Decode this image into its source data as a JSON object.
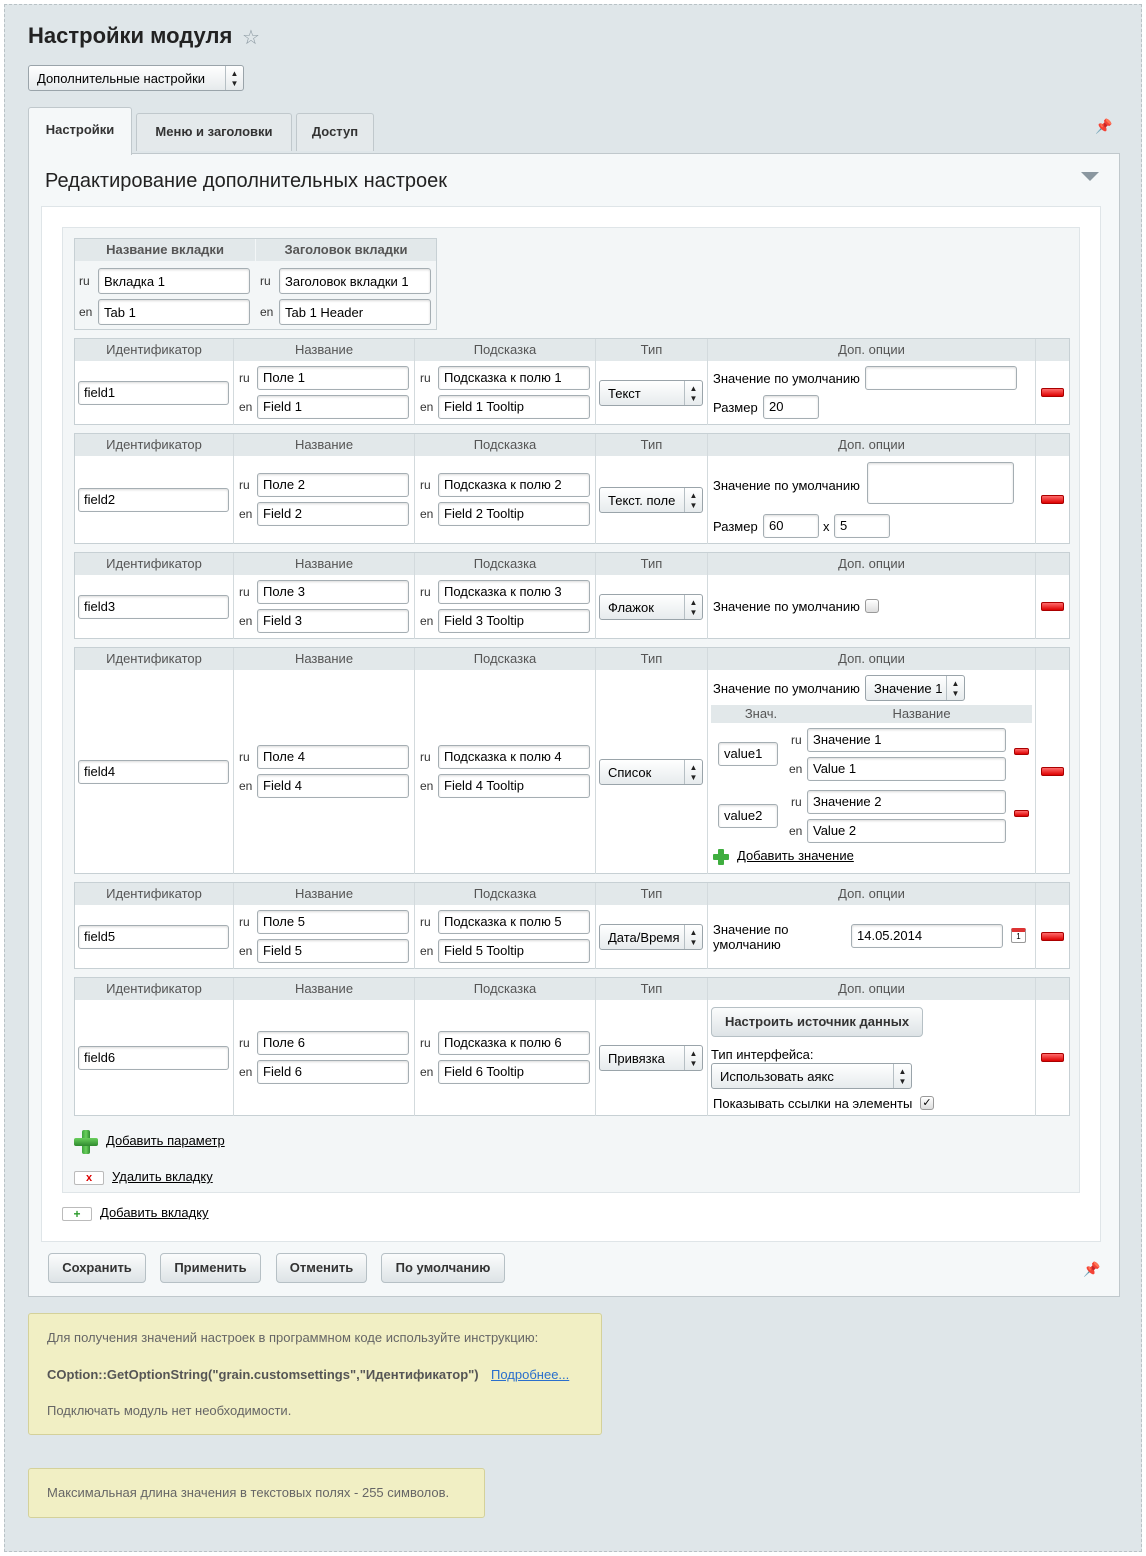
{
  "page": {
    "title": "Настройки модуля",
    "module_select": "Дополнительные настройки",
    "tabs": [
      "Настройки",
      "Меню и заголовки",
      "Доступ"
    ],
    "panel_title": "Редактирование дополнительных настроек"
  },
  "tabhead": {
    "col_name": "Название вкладки",
    "col_header": "Заголовок вкладки",
    "ru_label": "ru",
    "en_label": "en",
    "name_ru": "Вкладка 1",
    "name_en": "Tab 1",
    "header_ru": "Заголовок вкладки 1",
    "header_en": "Tab 1 Header"
  },
  "columns": {
    "id": "Идентификатор",
    "name": "Название",
    "hint": "Подсказка",
    "type": "Тип",
    "options": "Доп. опции"
  },
  "fields": [
    {
      "id": "field1",
      "name_ru": "Поле 1",
      "name_en": "Field 1",
      "hint_ru": "Подсказка к полю 1",
      "hint_en": "Field 1 Tooltip",
      "type": "Текст"
    },
    {
      "id": "field2",
      "name_ru": "Поле 2",
      "name_en": "Field 2",
      "hint_ru": "Подсказка к полю 2",
      "hint_en": "Field 2 Tooltip",
      "type": "Текст. поле"
    },
    {
      "id": "field3",
      "name_ru": "Поле 3",
      "name_en": "Field 3",
      "hint_ru": "Подсказка к полю 3",
      "hint_en": "Field 3 Tooltip",
      "type": "Флажок"
    },
    {
      "id": "field4",
      "name_ru": "Поле 4",
      "name_en": "Field 4",
      "hint_ru": "Подсказка к полю 4",
      "hint_en": "Field 4 Tooltip",
      "type": "Список"
    },
    {
      "id": "field5",
      "name_ru": "Поле 5",
      "name_en": "Field 5",
      "hint_ru": "Подсказка к полю 5",
      "hint_en": "Field 5 Tooltip",
      "type": "Дата/Время"
    },
    {
      "id": "field6",
      "name_ru": "Поле 6",
      "name_en": "Field 6",
      "hint_ru": "Подсказка к полю 6",
      "hint_en": "Field 6 Tooltip",
      "type": "Привязка"
    }
  ],
  "opts": {
    "default_value": "Значение по умолчанию",
    "default_value_l1": "Значение по",
    "default_value_l2": "умолчанию",
    "size": "Размер",
    "f1_default": "",
    "f1_size": "20",
    "f2_default": "",
    "f2_size_w": "60",
    "f2_x": "x",
    "f2_size_h": "5",
    "f4_default_select": "Значение 1",
    "f4_col_val": "Знач.",
    "f4_col_name": "Название",
    "f4_values": [
      {
        "val": "value1",
        "ru": "Значение 1",
        "en": "Value 1"
      },
      {
        "val": "value2",
        "ru": "Значение 2",
        "en": "Value 2"
      }
    ],
    "f4_add_value": "Добавить значение",
    "f5_date": "14.05.2014",
    "f6_source_btn": "Настроить источник данных",
    "f6_interface_label": "Тип интерфейса:",
    "f6_interface_select": "Использовать аякс",
    "f6_show_links": "Показывать ссылки на элементы"
  },
  "actions": {
    "add_param": "Добавить параметр",
    "delete_tab": "Удалить вкладку",
    "add_tab": "Добавить вкладку"
  },
  "buttons": {
    "save": "Сохранить",
    "apply": "Применить",
    "cancel": "Отменить",
    "default": "По умолчанию"
  },
  "notes": {
    "line1": "Для получения значений настроек в программном коде используйте инструкцию:",
    "code": "COption::GetOptionString(\"grain.customsettings\",\"Идентификатор\")",
    "more": "Подробнее...",
    "line3": "Подключать модуль нет необходимости.",
    "maxlen": "Максимальная длина значения в текстовых полях - 255 символов."
  }
}
